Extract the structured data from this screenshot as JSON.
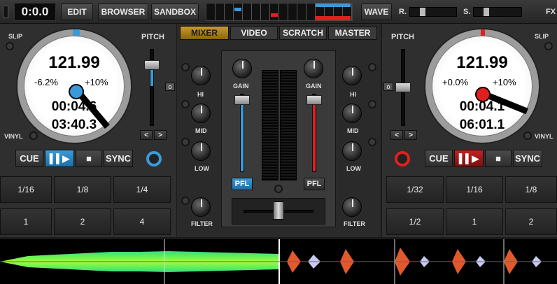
{
  "topbar": {
    "clock": "0:0.0",
    "buttons": [
      "EDIT",
      "BROWSER",
      "SANDBOX"
    ],
    "wave_label": "WAVE",
    "r_label": "R.",
    "s_label": "S.",
    "fx_label": "FX"
  },
  "deck_left": {
    "slip": "SLIP",
    "pitch": "PITCH",
    "vinyl": "VINYL",
    "bpm": "121.99",
    "pitch_val": "-6.2%",
    "range": "+10%",
    "elapsed": "00:04.6",
    "remain": "03:40.3",
    "cue": "CUE",
    "play": "▌▌▶",
    "stop": "■",
    "sync": "SYNC",
    "nudge_left": "<",
    "nudge_right": ">",
    "pads": [
      "1/16",
      "1/8",
      "1/4",
      "1",
      "2",
      "4"
    ],
    "accent": "#3a9ad9"
  },
  "deck_right": {
    "slip": "SLIP",
    "pitch": "PITCH",
    "vinyl": "VINYL",
    "bpm": "121.99",
    "pitch_val": "+0.0%",
    "range": "+10%",
    "elapsed": "00:04.1",
    "remain": "06:01.1",
    "cue": "CUE",
    "play": "▌▌▶",
    "stop": "■",
    "sync": "SYNC",
    "nudge_left": "<",
    "nudge_right": ">",
    "pads": [
      "1/32",
      "1/16",
      "1/8",
      "1/2",
      "1",
      "2"
    ],
    "accent": "#e02020"
  },
  "mixer": {
    "tabs": [
      "MIXER",
      "VIDEO",
      "SCRATCH",
      "MASTER"
    ],
    "gain": "GAIN",
    "hi": "HI",
    "mid": "MID",
    "low": "LOW",
    "filter": "FILTER",
    "pfl": "PFL",
    "o": "o"
  }
}
